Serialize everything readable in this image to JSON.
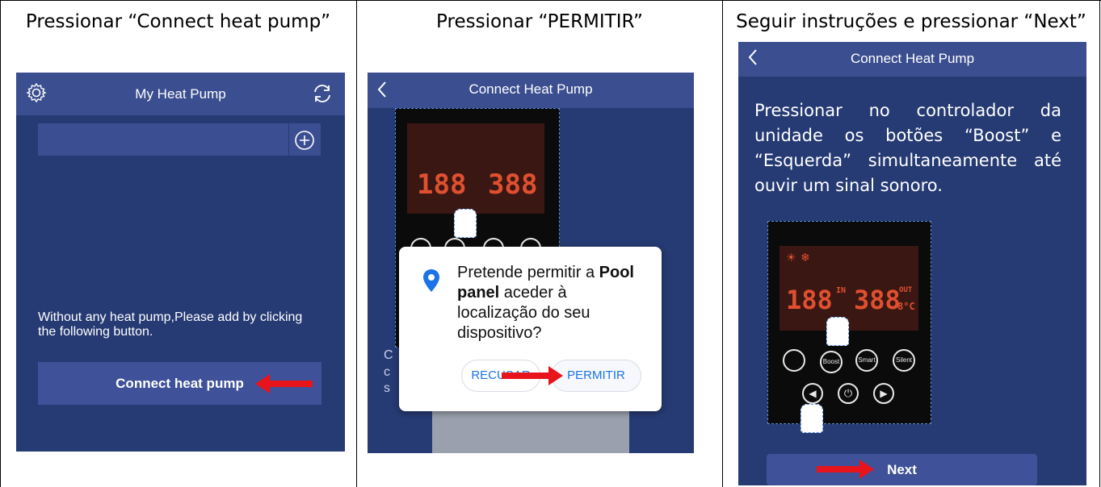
{
  "captions": {
    "col1": "Pressionar “Connect heat pump”",
    "col2": "Pressionar “PERMITIR”",
    "col3": "Seguir instruções e pressionar “Next”"
  },
  "screen1": {
    "title": "My Heat Pump",
    "icons": {
      "left": "gear-icon",
      "right": "refresh-icon",
      "add": "plus-circle-icon"
    },
    "empty_message": "Without any heat pump,Please add by clicking the following button.",
    "connect_button": "Connect heat pump"
  },
  "screen2": {
    "title": "Connect Heat Pump",
    "dialog": {
      "icon": "location-pin-icon",
      "text_before": "Pretende permitir a ",
      "app_name": "Pool panel",
      "text_after": " aceder à localização do seu dispositivo?",
      "deny_button": "RECUSAR",
      "allow_button": "PERMITIR"
    },
    "hidden_text_fragments": [
      "C",
      "c",
      "s"
    ]
  },
  "screen3": {
    "title": "Connect Heat Pump",
    "instruction": "Pressionar no controlador da unidade os botões “Boost” e “Esquerda” simultaneamente até ouvir um sinal sonoro.",
    "next_button": "Next"
  },
  "controller": {
    "digits_left": "188",
    "digits_right": "388",
    "small_left": "IN",
    "small_right": "OUT",
    "unit_right": "8°C",
    "btn_boost": "Boost",
    "btn_smart": "Smart",
    "btn_silent": "Silent"
  },
  "colors": {
    "app_background": "#263a73",
    "top_bar": "#3b4e8f",
    "button": "#3f5199",
    "arrow": "#e8141c",
    "dialog_accent": "#1a73e8"
  }
}
